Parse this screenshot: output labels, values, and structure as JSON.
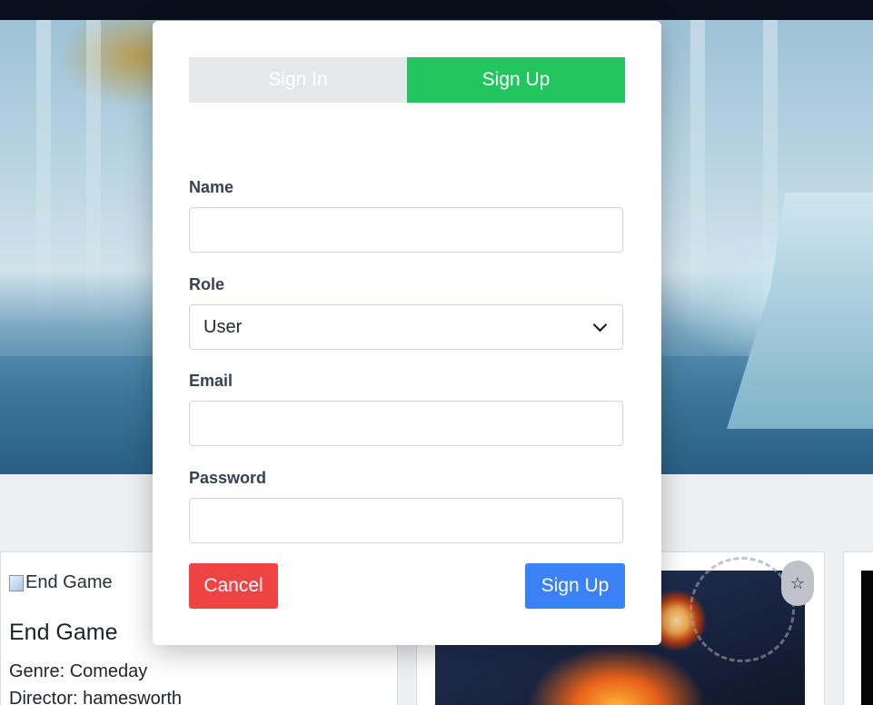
{
  "modal": {
    "tabs": {
      "signin_label": "Sign In",
      "signup_label": "Sign Up"
    },
    "fields": {
      "name_label": "Name",
      "name_value": "",
      "role_label": "Role",
      "role_value": "User",
      "email_label": "Email",
      "email_value": "",
      "password_label": "Password",
      "password_value": ""
    },
    "buttons": {
      "cancel_label": "Cancel",
      "submit_label": "Sign Up"
    }
  },
  "cards": {
    "card1": {
      "image_alt": "End Game",
      "title": "End Game",
      "genre": "Genre: Comeday",
      "director": "Director: hamesworth"
    },
    "card2": {
      "favorite_icon": "☆"
    }
  },
  "colors": {
    "tab_active": "#22c55e",
    "tab_inactive": "#e5e7eb",
    "cancel": "#ef4444",
    "submit": "#3b82f6",
    "topbar": "#0a0f1d"
  }
}
